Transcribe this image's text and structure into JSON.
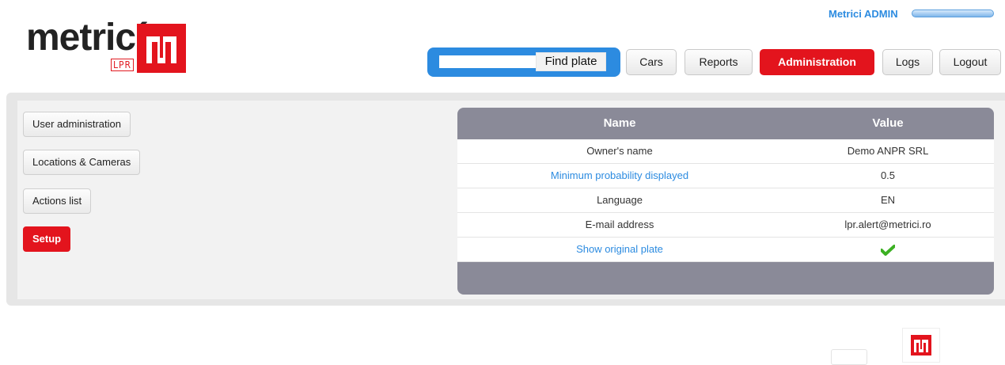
{
  "header": {
    "logo": {
      "word": "metricí",
      "sub": "LPR"
    },
    "user": {
      "name": "Metrici ADMIN"
    },
    "search": {
      "placeholder": "",
      "button_label": "Find plate"
    },
    "nav": [
      {
        "label": "Cars"
      },
      {
        "label": "Reports"
      },
      {
        "label": "Administration",
        "active": true
      },
      {
        "label": "Logs"
      },
      {
        "label": "Logout"
      }
    ]
  },
  "sidebar": {
    "items": [
      {
        "label": "User administration"
      },
      {
        "label": "Locations & Cameras"
      },
      {
        "label": "Actions list"
      },
      {
        "label": "Setup",
        "active": true
      }
    ]
  },
  "settings_table": {
    "columns": [
      "Name",
      "Value"
    ],
    "rows": [
      {
        "name": "Owner's name",
        "value": "Demo ANPR SRL"
      },
      {
        "name": "Minimum probability displayed",
        "value": "0.5"
      },
      {
        "name": "Language",
        "value": "EN"
      },
      {
        "name": "E-mail address",
        "value": "lpr.alert@metrici.ro"
      },
      {
        "name": "Show original plate",
        "value": "",
        "value_icon": "check-icon"
      }
    ]
  },
  "colors": {
    "brand_red": "#e3141d",
    "accent_blue": "#2c8be0",
    "table_header": "#8a8a98",
    "check_green": "#3cb023"
  }
}
